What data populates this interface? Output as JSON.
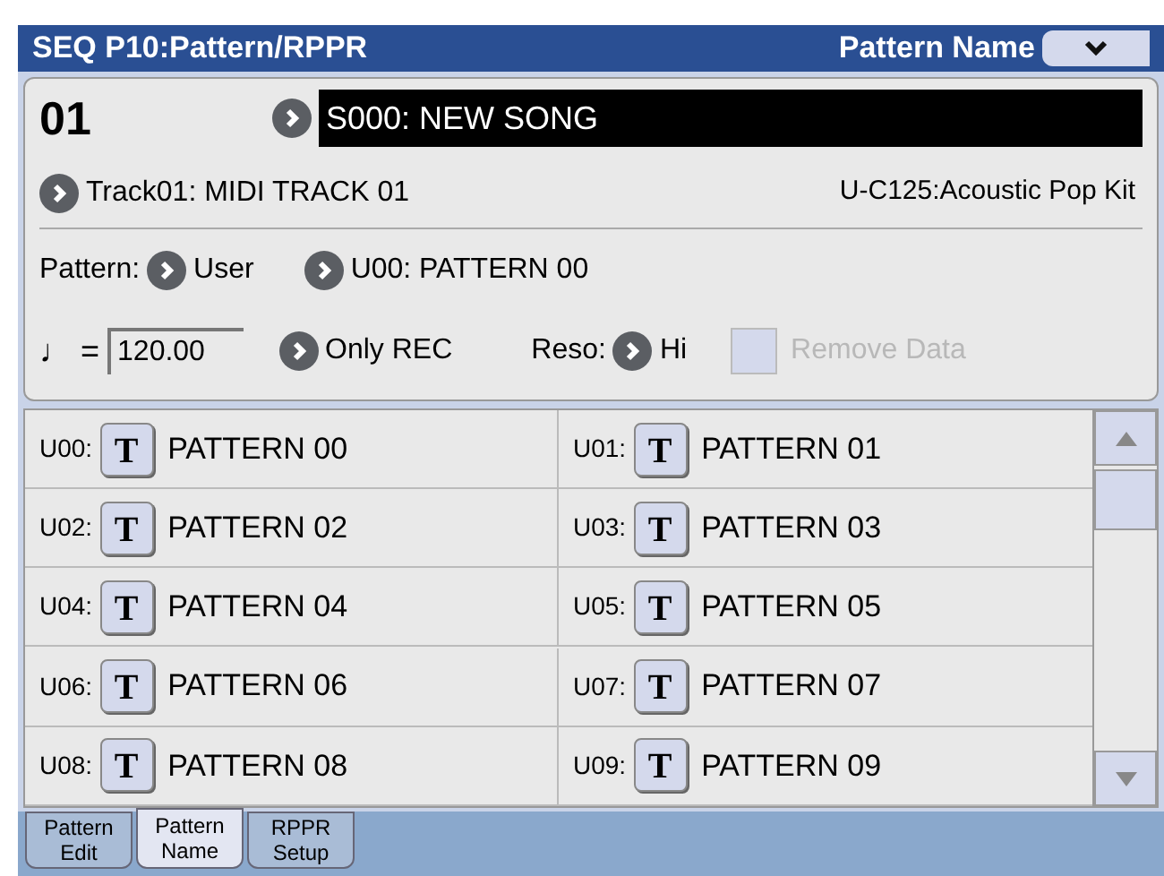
{
  "header": {
    "title": "SEQ P10:Pattern/RPPR",
    "page_name": "Pattern Name"
  },
  "song": {
    "number": "01",
    "name": "S000: NEW SONG"
  },
  "track": {
    "name": "Track01: MIDI TRACK 01",
    "program": "U-C125:Acoustic Pop Kit"
  },
  "pattern": {
    "label": "Pattern:",
    "bank": "User",
    "name": "U00: PATTERN 00"
  },
  "tempo": {
    "label": "♩ =",
    "value": "120.00"
  },
  "rec_mode": "Only REC",
  "reso": {
    "label": "Reso:",
    "value": "Hi"
  },
  "remove_data": {
    "label": "Remove Data",
    "checked": false,
    "disabled": true
  },
  "patterns": [
    {
      "id": "U00:",
      "button": "T",
      "name": "PATTERN 00"
    },
    {
      "id": "U01:",
      "button": "T",
      "name": "PATTERN 01"
    },
    {
      "id": "U02:",
      "button": "T",
      "name": "PATTERN 02"
    },
    {
      "id": "U03:",
      "button": "T",
      "name": "PATTERN 03"
    },
    {
      "id": "U04:",
      "button": "T",
      "name": "PATTERN 04"
    },
    {
      "id": "U05:",
      "button": "T",
      "name": "PATTERN 05"
    },
    {
      "id": "U06:",
      "button": "T",
      "name": "PATTERN 06"
    },
    {
      "id": "U07:",
      "button": "T",
      "name": "PATTERN 07"
    },
    {
      "id": "U08:",
      "button": "T",
      "name": "PATTERN 08"
    },
    {
      "id": "U09:",
      "button": "T",
      "name": "PATTERN 09"
    }
  ],
  "tabs": [
    {
      "label": "Pattern Edit",
      "selected": false
    },
    {
      "label": "Pattern Name",
      "selected": true
    },
    {
      "label": "RPPR Setup",
      "selected": false
    }
  ]
}
